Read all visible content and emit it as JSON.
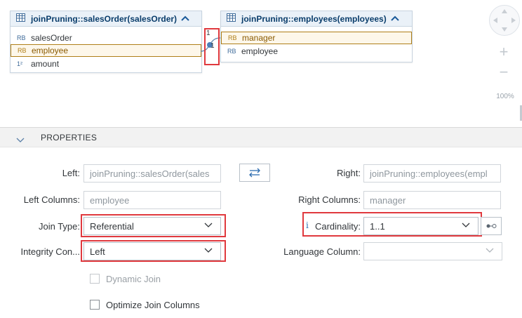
{
  "left_table": {
    "title": "joinPruning::salesOrder(salesOrder)",
    "columns": [
      {
        "type": "ᴿᴮ",
        "name": "salesOrder",
        "selected": false
      },
      {
        "type": "ᴿᴮ",
        "name": "employee",
        "selected": true
      },
      {
        "type": "¹²",
        "name": "amount",
        "selected": false
      }
    ]
  },
  "right_table": {
    "title": "joinPruning::employees(employees)",
    "columns": [
      {
        "type": "ᴿᴮ",
        "name": "manager",
        "selected": true
      },
      {
        "type": "ᴿᴮ",
        "name": "employee",
        "selected": false
      }
    ]
  },
  "join_link": {
    "left_card": "1",
    "right_card": "1"
  },
  "zoom": {
    "level": "100%"
  },
  "properties": {
    "title": "PROPERTIES",
    "left_label": "Left:",
    "left_value": "joinPruning::salesOrder(sales",
    "right_label": "Right:",
    "right_value": "joinPruning::employees(empl",
    "left_columns_label": "Left Columns:",
    "left_columns_value": "employee",
    "right_columns_label": "Right Columns:",
    "right_columns_value": "manager",
    "join_type_label": "Join Type:",
    "join_type_value": "Referential",
    "cardinality_label": "Cardinality:",
    "cardinality_value": "1..1",
    "integrity_label": "Integrity Con...",
    "integrity_value": "Left",
    "language_label": "Language Column:",
    "language_value": "",
    "dynamic_join_label": "Dynamic Join",
    "optimize_label": "Optimize Join Columns"
  },
  "colors": {
    "highlight_red": "#e0393e",
    "selected_gold": "#b07f18",
    "header_blue": "#0a3d6b"
  }
}
